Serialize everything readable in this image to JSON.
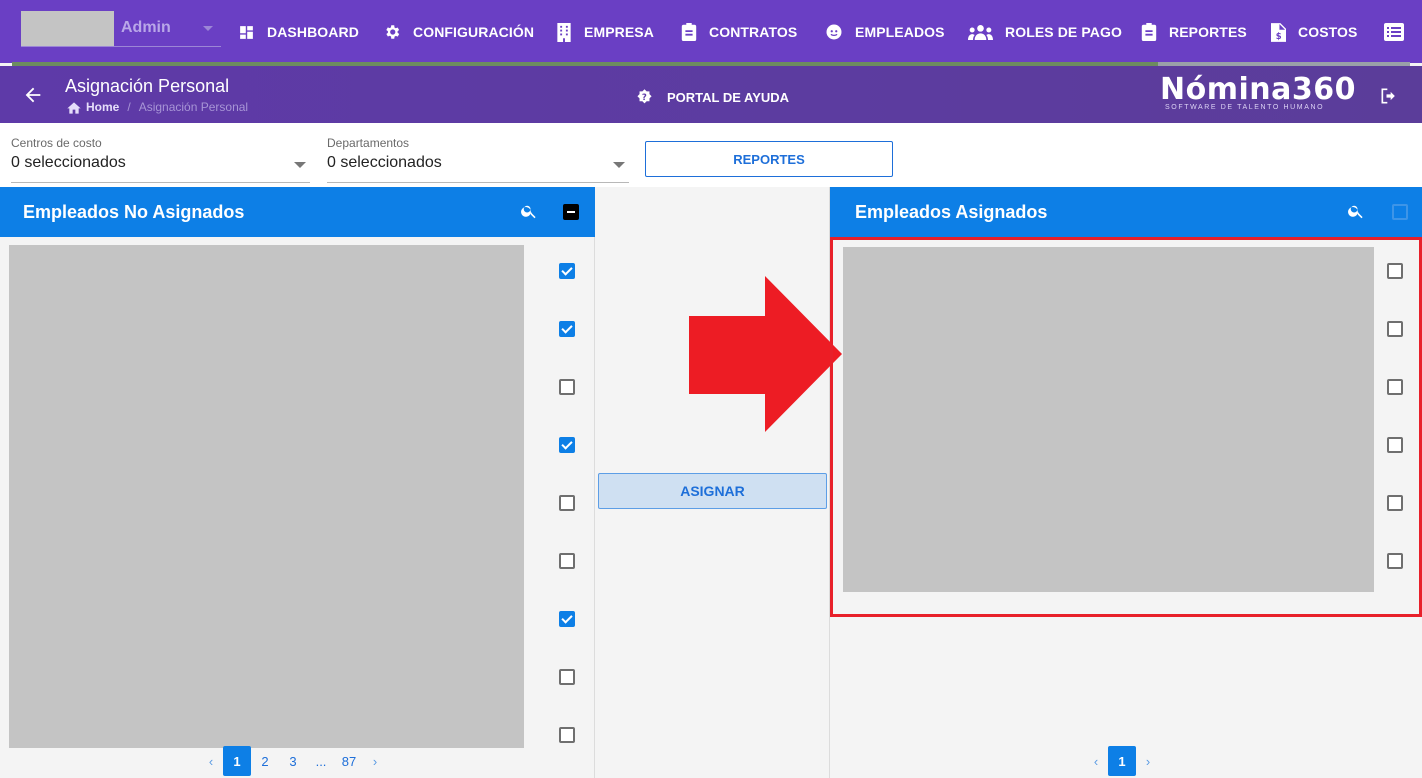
{
  "nav": {
    "user_name": "Admin",
    "items": [
      {
        "label": "DASHBOARD",
        "icon": "dashboard-icon"
      },
      {
        "label": "CONFIGURACIÓN",
        "icon": "gear-icon"
      },
      {
        "label": "EMPRESA",
        "icon": "building-icon"
      },
      {
        "label": "CONTRATOS",
        "icon": "clipboard-icon"
      },
      {
        "label": "EMPLEADOS",
        "icon": "employee-face-icon"
      },
      {
        "label": "ROLES DE PAGO",
        "icon": "people-group-icon"
      },
      {
        "label": "REPORTES",
        "icon": "report-clipboard-icon"
      },
      {
        "label": "COSTOS",
        "icon": "invoice-dollar-icon"
      }
    ],
    "progress_fraction": 0.82
  },
  "header": {
    "title": "Asignación Personal",
    "breadcrumb_home": "Home",
    "breadcrumb_separator": "/",
    "breadcrumb_current": "Asignación Personal",
    "help_label": "PORTAL DE AYUDA",
    "brand_name": "Nómina360",
    "brand_tagline": "SOFTWARE DE TALENTO HUMANO"
  },
  "filters": {
    "cost_centers": {
      "label": "Centros de costo",
      "value": "0 seleccionados"
    },
    "departments": {
      "label": "Departamentos",
      "value": "0 seleccionados"
    },
    "reports_button": "REPORTES"
  },
  "left_panel": {
    "title": "Empleados No Asignados",
    "header_checkbox": "indeterminate",
    "rows_checked": [
      true,
      true,
      false,
      true,
      false,
      false,
      true,
      false,
      false
    ],
    "pagination": {
      "pages": [
        "1",
        "2",
        "3",
        "...",
        "87"
      ],
      "active": "1"
    }
  },
  "middle": {
    "assign_button": "ASIGNAR"
  },
  "right_panel": {
    "title": "Empleados Asignados",
    "header_checkbox": "unchecked",
    "rows_checked": [
      false,
      false,
      false,
      false,
      false,
      false
    ],
    "pagination": {
      "pages": [
        "1"
      ],
      "active": "1"
    }
  },
  "colors": {
    "nav_bg": "#6a3fc4",
    "header_bg": "#5e3aa8",
    "panel_header": "#0d7fe6",
    "accent": "#1e6fd9",
    "annotation_red": "#e8202a"
  }
}
